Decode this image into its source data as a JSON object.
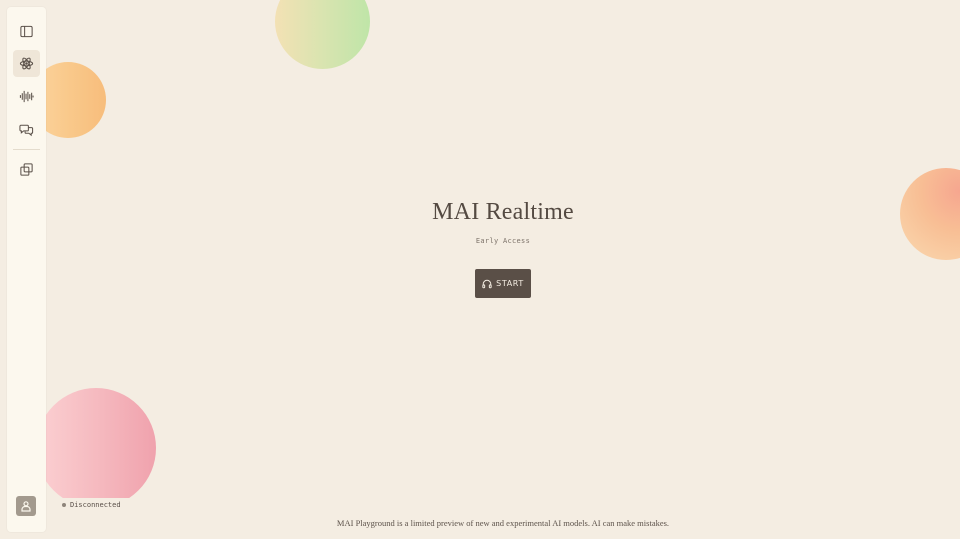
{
  "colors": {
    "background": "#f4ede2",
    "sidebar": "#fcf8ee",
    "button": "#5a4f47",
    "text": "#544a42"
  },
  "sidebar": {
    "items": [
      {
        "icon": "sidebar-toggle-icon",
        "active": false
      },
      {
        "icon": "atom-icon",
        "active": true
      },
      {
        "icon": "waveform-icon",
        "active": false
      },
      {
        "icon": "chat-bubbles-icon",
        "active": false
      },
      {
        "icon": "copy-icon",
        "active": false
      }
    ],
    "avatar_icon": "user-icon"
  },
  "main": {
    "title": "MAI Realtime",
    "subtitle": "Early Access",
    "start_button": {
      "label": "START",
      "icon": "headphones-icon"
    }
  },
  "status": {
    "label": "Disconnected"
  },
  "footer": {
    "text": "MAI Playground is a limited preview of new and experimental AI models. AI can make mistakes."
  }
}
